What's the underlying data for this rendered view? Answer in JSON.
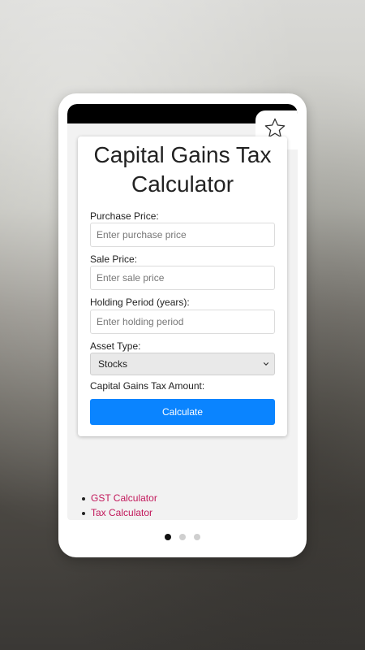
{
  "app": {
    "title_line1": "Capital Gains Tax",
    "title_line2": "Calculator"
  },
  "form": {
    "purchase_price": {
      "label": "Purchase Price:",
      "placeholder": "Enter purchase price",
      "value": ""
    },
    "sale_price": {
      "label": "Sale Price:",
      "placeholder": "Enter sale price",
      "value": ""
    },
    "holding_period": {
      "label": "Holding Period (years):",
      "placeholder": "Enter holding period",
      "value": ""
    },
    "asset_type": {
      "label": "Asset Type:",
      "selected": "Stocks"
    },
    "result_label": "Capital Gains Tax Amount:",
    "calculate_label": "Calculate"
  },
  "links": [
    {
      "label": "GST Calculator"
    },
    {
      "label": "Tax Calculator"
    }
  ],
  "pager": {
    "count": 3,
    "active_index": 0
  },
  "icons": {
    "favorite": "star-outline-icon",
    "dropdown": "chevron-down-icon"
  },
  "colors": {
    "accent": "#0a84ff",
    "link": "#c2185b",
    "statusbar": "#000000"
  }
}
